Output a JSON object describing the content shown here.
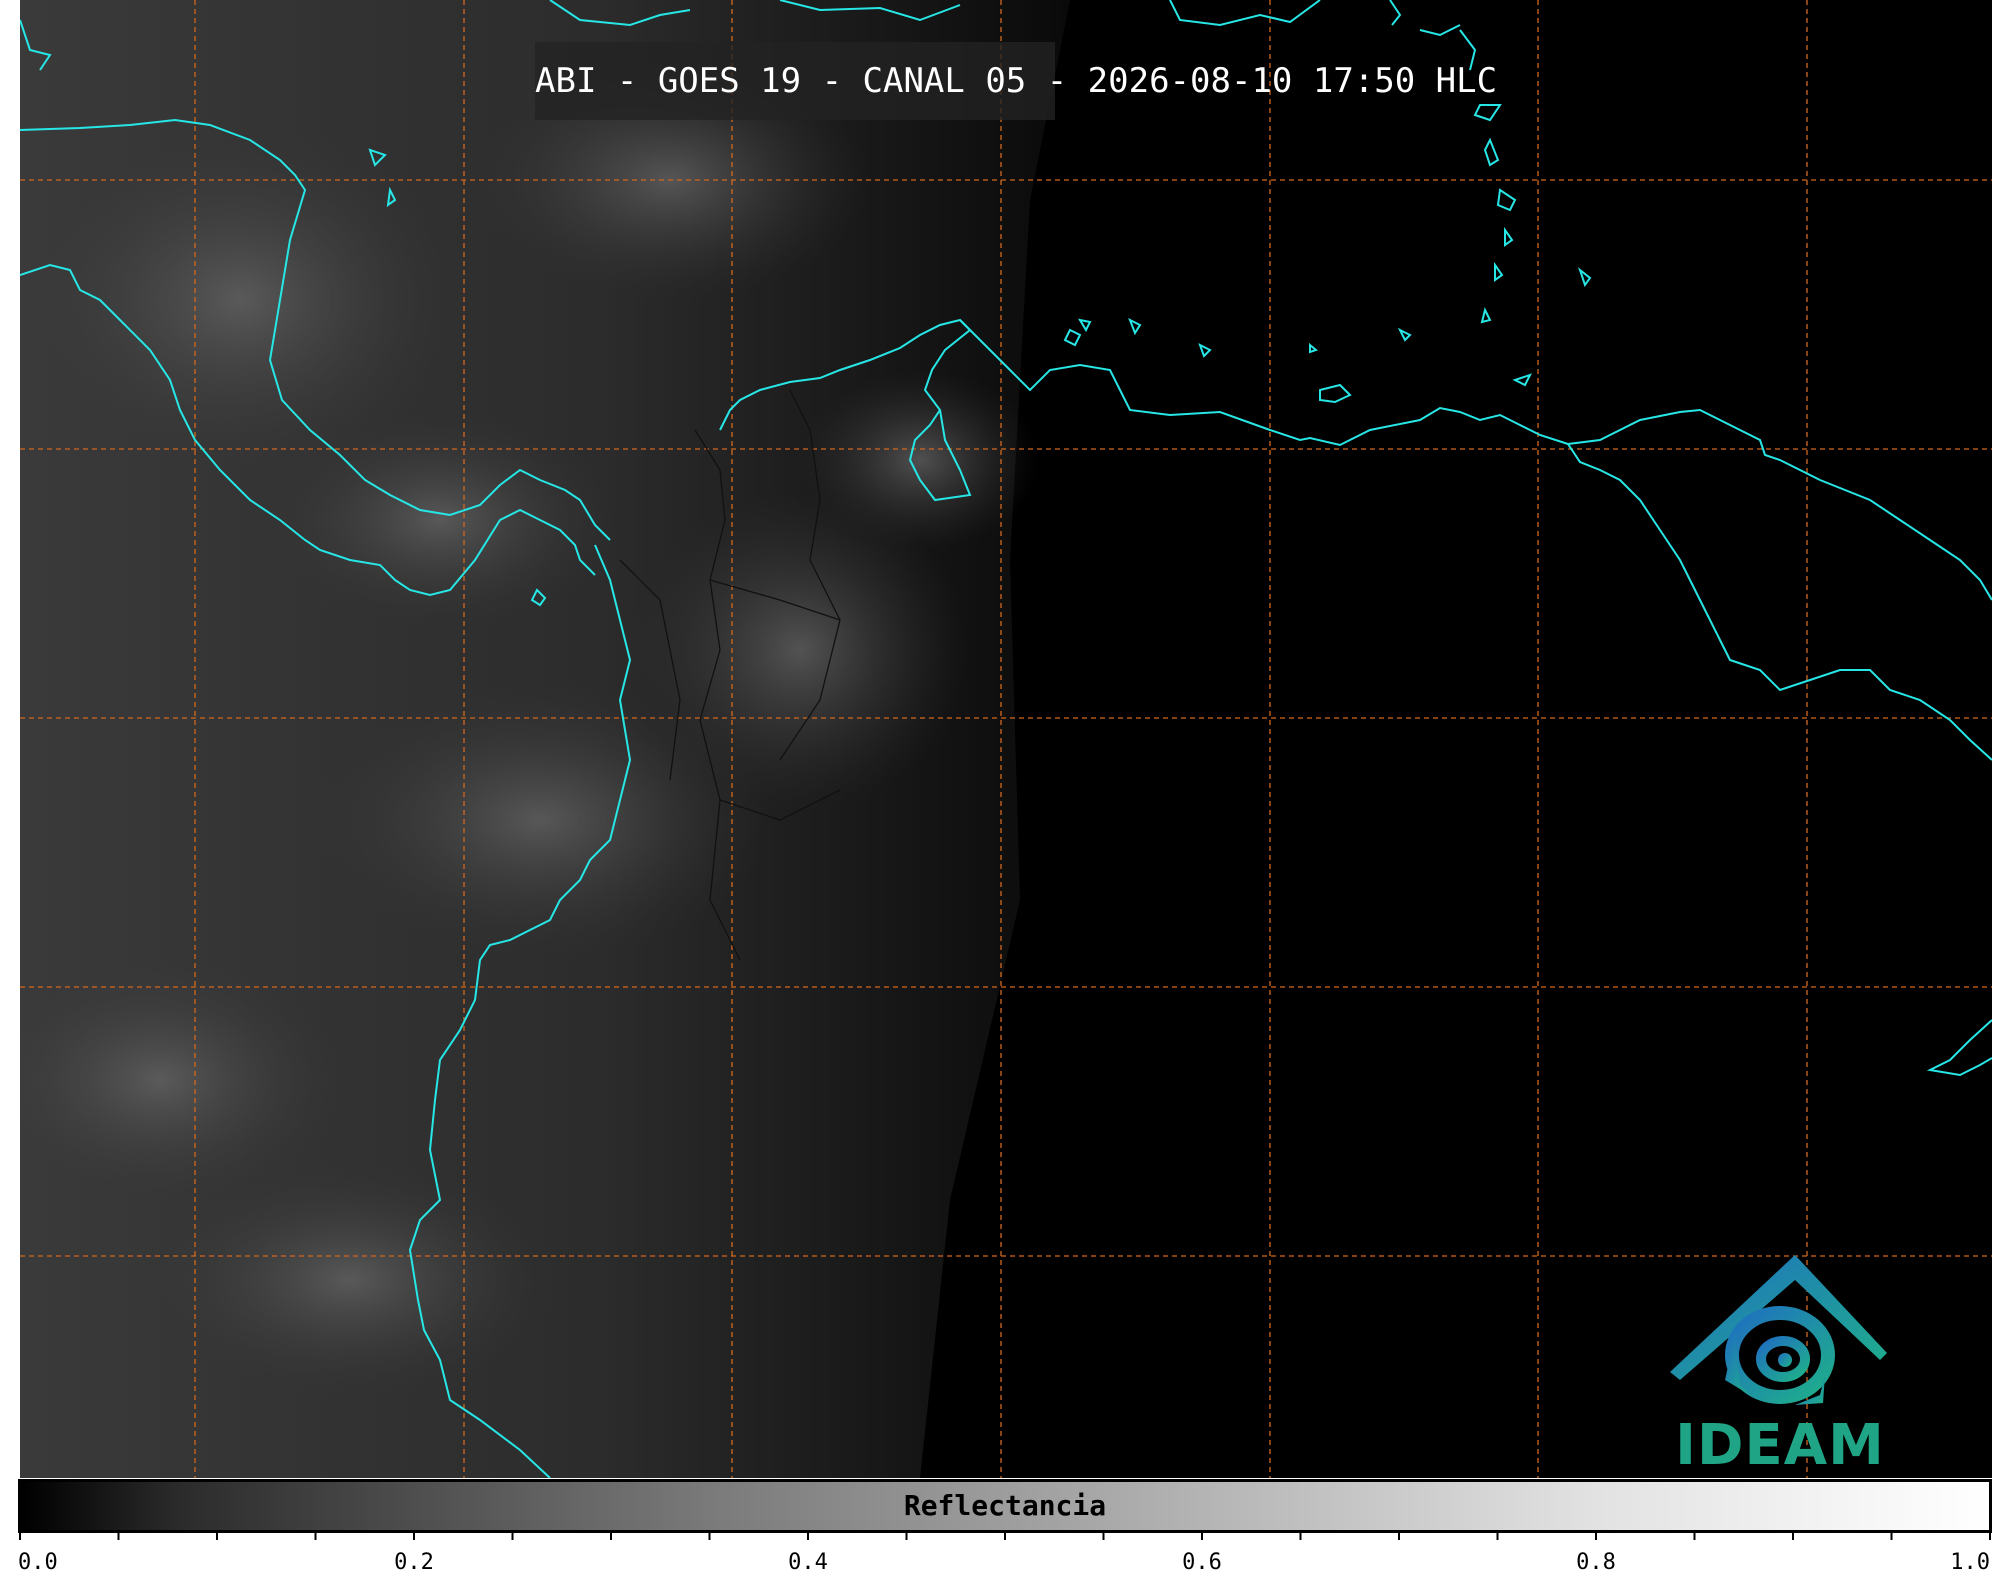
{
  "title": "ABI - GOES 19 - CANAL 05 - 2026-08-10 17:50 HLC",
  "logo_text": "IDEAM",
  "colorbar": {
    "label": "Reflectancia",
    "min": 0.0,
    "max": 1.0,
    "tick_labels": [
      "0.0",
      "0.2",
      "0.4",
      "0.6",
      "0.8",
      "1.0"
    ],
    "minor_tick_step": 0.05
  },
  "colors": {
    "coastline": "#27e6e6",
    "graticule": "#d2691e",
    "logo_blue": "#1f7fb5",
    "logo_green": "#1fa585"
  }
}
